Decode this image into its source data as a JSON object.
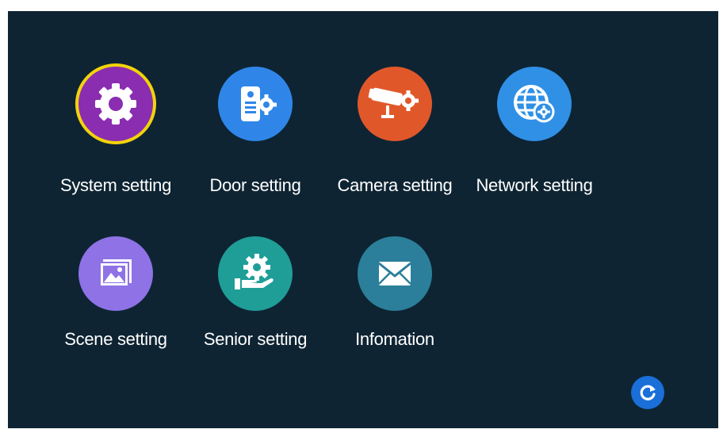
{
  "menu": {
    "items": [
      {
        "label": "System setting",
        "icon": "gear-icon",
        "color": "#8a2db0",
        "ring": "#f2d30a"
      },
      {
        "label": "Door setting",
        "icon": "door-intercom-icon",
        "color": "#2f86e8"
      },
      {
        "label": "Camera setting",
        "icon": "camera-icon",
        "color": "#e0582a"
      },
      {
        "label": "Network setting",
        "icon": "globe-icon",
        "color": "#2f90e6"
      },
      {
        "label": "Scene setting",
        "icon": "picture-icon",
        "color": "#8e72e6"
      },
      {
        "label": "Senior setting",
        "icon": "hand-gear-icon",
        "color": "#1f9e98"
      },
      {
        "label": "Infomation",
        "icon": "envelope-icon",
        "color": "#2b7f9a"
      }
    ]
  },
  "refresh": {
    "icon": "refresh-icon",
    "color": "#1a6fd8"
  }
}
